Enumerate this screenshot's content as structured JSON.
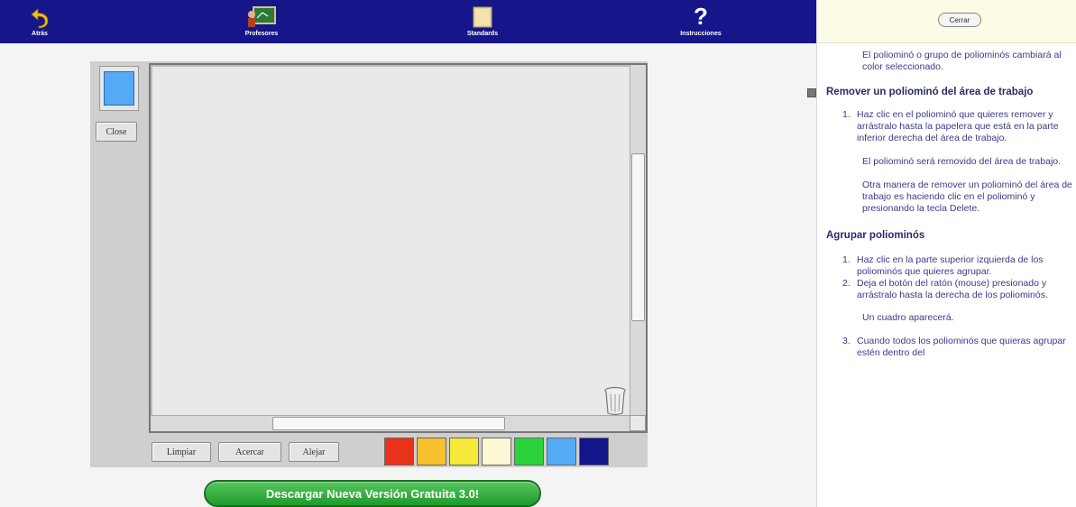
{
  "nav": {
    "back_label": "Atrás",
    "teachers_label": "Profesores",
    "standards_label": "Standards",
    "instructions_label": "Instrucciones",
    "help_glyph": "?"
  },
  "workspace": {
    "selected_color": "#55aaf5",
    "close_label": "Close",
    "buttons": {
      "clear_label": "Limpiar",
      "zoom_in_label": "Acercar",
      "zoom_out_label": "Alejar"
    },
    "palette": [
      "#e8321a",
      "#f7c12e",
      "#f5ea3a",
      "#fbf7d2",
      "#2bd33a",
      "#55aaf5",
      "#12168a"
    ],
    "download_label": "Descargar Nueva Versión Gratuita 3.0!"
  },
  "help": {
    "close_label": "Cerrar",
    "intro": "El poliominó o grupo de poliominós cambiará al color seleccionado.",
    "remove": {
      "heading": "Remover un poliominó del área de trabajo",
      "step1_num": "1.",
      "step1": "Haz clic en el poliominó que quieres remover y arrástralo hasta la papelera que está en la parte inferior derecha del área de trabajo.",
      "note1": "El poliominó será removido del área de trabajo.",
      "note2": "Otra manera de remover un poliominó del área de trabajo es haciendo clic en el poliominó y presionando la tecla Delete."
    },
    "group": {
      "heading": "Agrupar poliominós",
      "step1_num": "1.",
      "step1": "Haz clic en la parte superior izquierda de los poliominós que quieres agrupar.",
      "step2_num": "2.",
      "step2": "Deja el botón del ratón (mouse) presionado y arrástralo hasta la derecha de los poliominós.",
      "note1": "Un cuadro aparecerá.",
      "step3_num": "3.",
      "step3": "Cuando todos los poliominós que quieras agrupar estén dentro del"
    }
  }
}
